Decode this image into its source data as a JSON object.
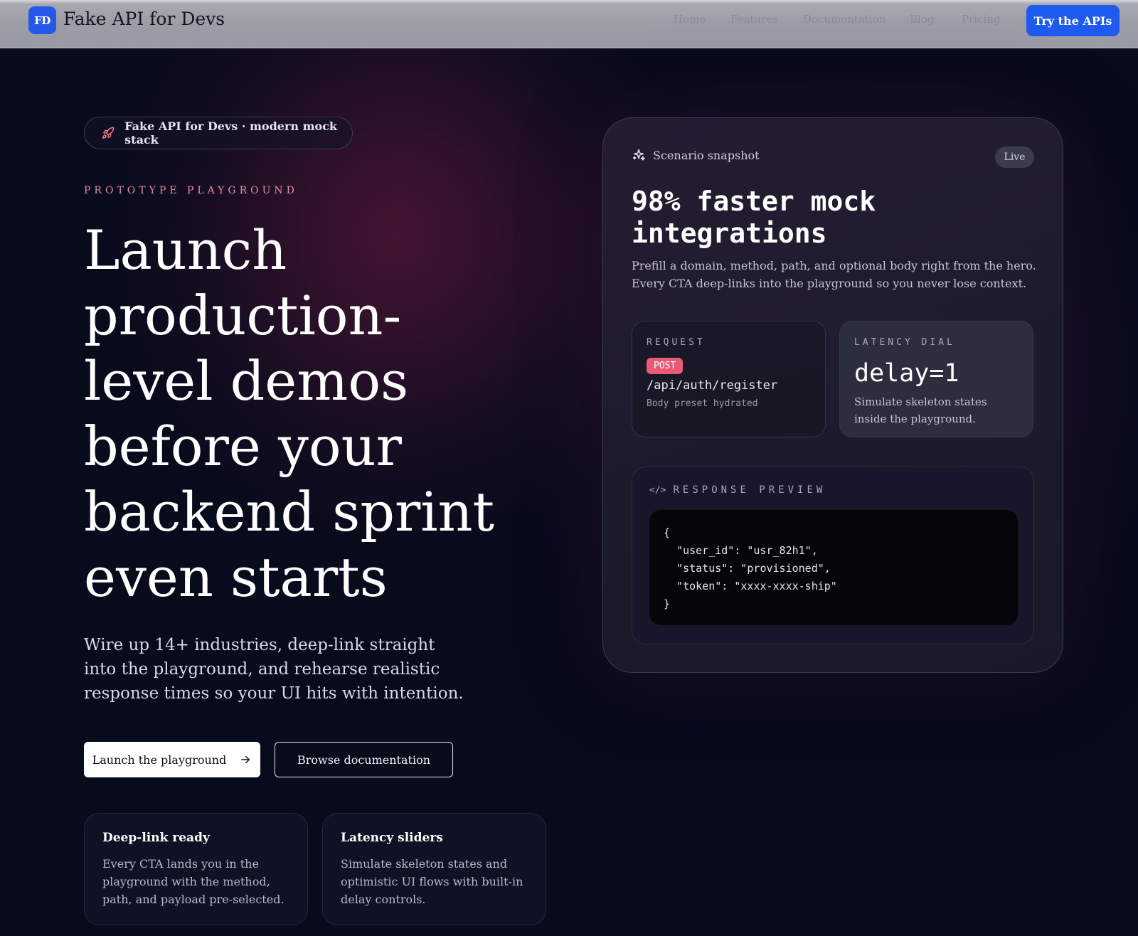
{
  "nav": {
    "logo_badge": "FD",
    "brand": "Fake API for Devs",
    "links": [
      "Home",
      "Features",
      "Documentation",
      "Blog",
      "Pricing"
    ],
    "cta": "Try the APIs"
  },
  "hero": {
    "pill_icon": "rocket-icon",
    "pill_text": "Fake API for Devs · modern mock stack",
    "kicker": "PROTOTYPE PLAYGROUND",
    "headline": [
      "Launch",
      "production-",
      "level demos",
      "before your",
      "backend sprint",
      "even starts"
    ],
    "lede": [
      "Wire up 14+ industries, deep-link straight",
      "into the playground, and rehearse realistic",
      "response times so your UI hits with intention."
    ],
    "primary_button": "Launch the playground",
    "primary_button_icon": "arrow-right-icon",
    "secondary_button": "Browse documentation",
    "features": [
      {
        "title": "Deep-link ready",
        "body": "Every CTA lands you in the playground with the method, path, and payload pre-selected."
      },
      {
        "title": "Latency sliders",
        "body": "Simulate skeleton states and optimistic UI flows with built-in delay controls."
      }
    ]
  },
  "card": {
    "label_icon": "sparkle-icon",
    "label": "Scenario snapshot",
    "badge": "Live",
    "title": [
      "98% faster mock",
      "integrations"
    ],
    "description": [
      "Prefill a domain, method, path, and optional body right from the hero.",
      "Every CTA deep-links into the playground so you never lose context."
    ],
    "request": {
      "kicker": "REQUEST",
      "method": "POST",
      "path": "/api/auth/register",
      "note": "Body preset hydrated"
    },
    "latency": {
      "kicker": "LATENCY DIAL",
      "value": "delay=1",
      "note": "Simulate skeleton states inside the playground."
    },
    "response": {
      "icon": "code-icon",
      "kicker": "RESPONSE PREVIEW",
      "lines": [
        "{",
        "  \"user_id\": \"usr_82h1\",",
        "  \"status\": \"provisioned\",",
        "  \"token\": \"xxxx-xxxx-ship\"",
        "}"
      ]
    }
  },
  "colors": {
    "accent_blue": "#1f5af0",
    "kicker_pink": "#e88ca0",
    "method_chip": "#e85a78",
    "background": "#070b1c"
  }
}
